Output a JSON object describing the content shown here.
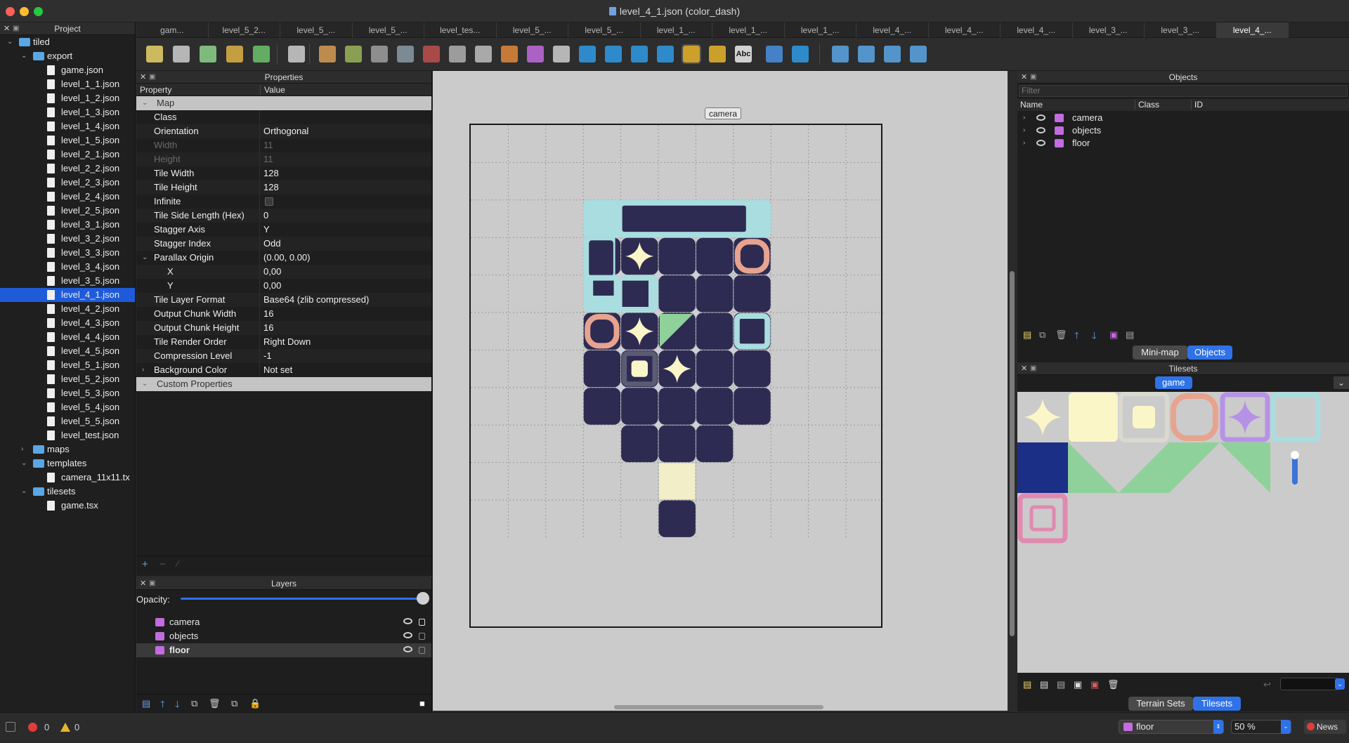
{
  "window": {
    "title": "level_4_1.json (color_dash)"
  },
  "tabs": [
    "gam...",
    "level_5_2...",
    "level_5_...",
    "level_5_...",
    "level_tes...",
    "level_5_...",
    "level_5_...",
    "level_1_...",
    "level_1_...",
    "level_1_...",
    "level_4_...",
    "level_4_...",
    "level_4_...",
    "level_3_...",
    "level_3_...",
    "level_4_..."
  ],
  "project": {
    "header": "Project",
    "tree": [
      {
        "label": "tiled",
        "kind": "folder",
        "depth": 0,
        "open": true
      },
      {
        "label": "export",
        "kind": "folder",
        "depth": 1,
        "open": true
      },
      {
        "label": "game.json",
        "kind": "file",
        "depth": 2
      },
      {
        "label": "level_1_1.json",
        "kind": "file",
        "depth": 2
      },
      {
        "label": "level_1_2.json",
        "kind": "file",
        "depth": 2
      },
      {
        "label": "level_1_3.json",
        "kind": "file",
        "depth": 2
      },
      {
        "label": "level_1_4.json",
        "kind": "file",
        "depth": 2
      },
      {
        "label": "level_1_5.json",
        "kind": "file",
        "depth": 2
      },
      {
        "label": "level_2_1.json",
        "kind": "file",
        "depth": 2
      },
      {
        "label": "level_2_2.json",
        "kind": "file",
        "depth": 2
      },
      {
        "label": "level_2_3.json",
        "kind": "file",
        "depth": 2
      },
      {
        "label": "level_2_4.json",
        "kind": "file",
        "depth": 2
      },
      {
        "label": "level_2_5.json",
        "kind": "file",
        "depth": 2
      },
      {
        "label": "level_3_1.json",
        "kind": "file",
        "depth": 2
      },
      {
        "label": "level_3_2.json",
        "kind": "file",
        "depth": 2
      },
      {
        "label": "level_3_3.json",
        "kind": "file",
        "depth": 2
      },
      {
        "label": "level_3_4.json",
        "kind": "file",
        "depth": 2
      },
      {
        "label": "level_3_5.json",
        "kind": "file",
        "depth": 2
      },
      {
        "label": "level_4_1.json",
        "kind": "file",
        "depth": 2,
        "selected": true
      },
      {
        "label": "level_4_2.json",
        "kind": "file",
        "depth": 2
      },
      {
        "label": "level_4_3.json",
        "kind": "file",
        "depth": 2
      },
      {
        "label": "level_4_4.json",
        "kind": "file",
        "depth": 2
      },
      {
        "label": "level_4_5.json",
        "kind": "file",
        "depth": 2
      },
      {
        "label": "level_5_1.json",
        "kind": "file",
        "depth": 2
      },
      {
        "label": "level_5_2.json",
        "kind": "file",
        "depth": 2
      },
      {
        "label": "level_5_3.json",
        "kind": "file",
        "depth": 2
      },
      {
        "label": "level_5_4.json",
        "kind": "file",
        "depth": 2
      },
      {
        "label": "level_5_5.json",
        "kind": "file",
        "depth": 2
      },
      {
        "label": "level_test.json",
        "kind": "file",
        "depth": 2
      },
      {
        "label": "maps",
        "kind": "folder",
        "depth": 1,
        "open": false
      },
      {
        "label": "templates",
        "kind": "folder",
        "depth": 1,
        "open": true
      },
      {
        "label": "camera_11x11.tx",
        "kind": "file",
        "depth": 2
      },
      {
        "label": "tilesets",
        "kind": "folder",
        "depth": 1,
        "open": true
      },
      {
        "label": "game.tsx",
        "kind": "file",
        "depth": 2
      }
    ]
  },
  "properties": {
    "header": "Properties",
    "col_property": "Property",
    "col_value": "Value",
    "rows": [
      {
        "key": "Map",
        "type": "group"
      },
      {
        "key": "Class",
        "value": ""
      },
      {
        "key": "Orientation",
        "value": "Orthogonal"
      },
      {
        "key": "Width",
        "value": "11",
        "disabled": true
      },
      {
        "key": "Height",
        "value": "11",
        "disabled": true
      },
      {
        "key": "Tile Width",
        "value": "128"
      },
      {
        "key": "Tile Height",
        "value": "128"
      },
      {
        "key": "Infinite",
        "value": "",
        "checkbox": true
      },
      {
        "key": "Tile Side Length (Hex)",
        "value": "0"
      },
      {
        "key": "Stagger Axis",
        "value": "Y"
      },
      {
        "key": "Stagger Index",
        "value": "Odd"
      },
      {
        "key": "Parallax Origin",
        "value": "(0.00, 0.00)",
        "expander": "v"
      },
      {
        "key": "X",
        "value": "0,00",
        "sub": true
      },
      {
        "key": "Y",
        "value": "0,00",
        "sub": true
      },
      {
        "key": "Tile Layer Format",
        "value": "Base64 (zlib compressed)"
      },
      {
        "key": "Output Chunk Width",
        "value": "16"
      },
      {
        "key": "Output Chunk Height",
        "value": "16"
      },
      {
        "key": "Tile Render Order",
        "value": "Right Down"
      },
      {
        "key": "Compression Level",
        "value": "-1"
      },
      {
        "key": "Background Color",
        "value": "Not set",
        "expander": ">"
      },
      {
        "key": "Custom Properties",
        "type": "group"
      }
    ]
  },
  "layers": {
    "header": "Layers",
    "opacity_label": "Opacity:",
    "opacity": 1.0,
    "items": [
      {
        "name": "camera",
        "current": false,
        "locked": true
      },
      {
        "name": "objects",
        "current": false,
        "locked": false
      },
      {
        "name": "floor",
        "current": true,
        "locked": false
      }
    ]
  },
  "canvas": {
    "camera_label": "camera",
    "map_width_tiles": 11,
    "map_height_tiles": 11,
    "colors": {
      "background": "#cbcbcb",
      "floor": "#2e2b52",
      "star": "#fbf6c8",
      "cyan": "#a9dde0",
      "salmon": "#e7a38e",
      "pale": "#f1eec8",
      "green": "#8fd19a"
    }
  },
  "objects": {
    "header": "Objects",
    "filter_placeholder": "Filter",
    "col_name": "Name",
    "col_class": "Class",
    "col_id": "ID",
    "items": [
      {
        "name": "camera"
      },
      {
        "name": "objects"
      },
      {
        "name": "floor"
      }
    ],
    "tab_minimap": "Mini-map",
    "tab_objects": "Objects"
  },
  "tilesets": {
    "header": "Tilesets",
    "active_tileset": "game",
    "tab_terrain": "Terrain Sets",
    "tab_tilesets": "Tilesets",
    "tiles": [
      "star-tile",
      "cream-tile",
      "cream-dot-tile",
      "salmon-ring-tile",
      "purple-star-tile",
      "cyan-frame-tile",
      "blue-tile",
      "green-slope-tile",
      "green-ramp-tile",
      "green-wedge-tile",
      "glow-tile",
      "pink-frame-tile"
    ]
  },
  "status": {
    "errors": "0",
    "warnings": "0",
    "current_layer": "floor",
    "zoom": "50 %",
    "news": "News"
  }
}
